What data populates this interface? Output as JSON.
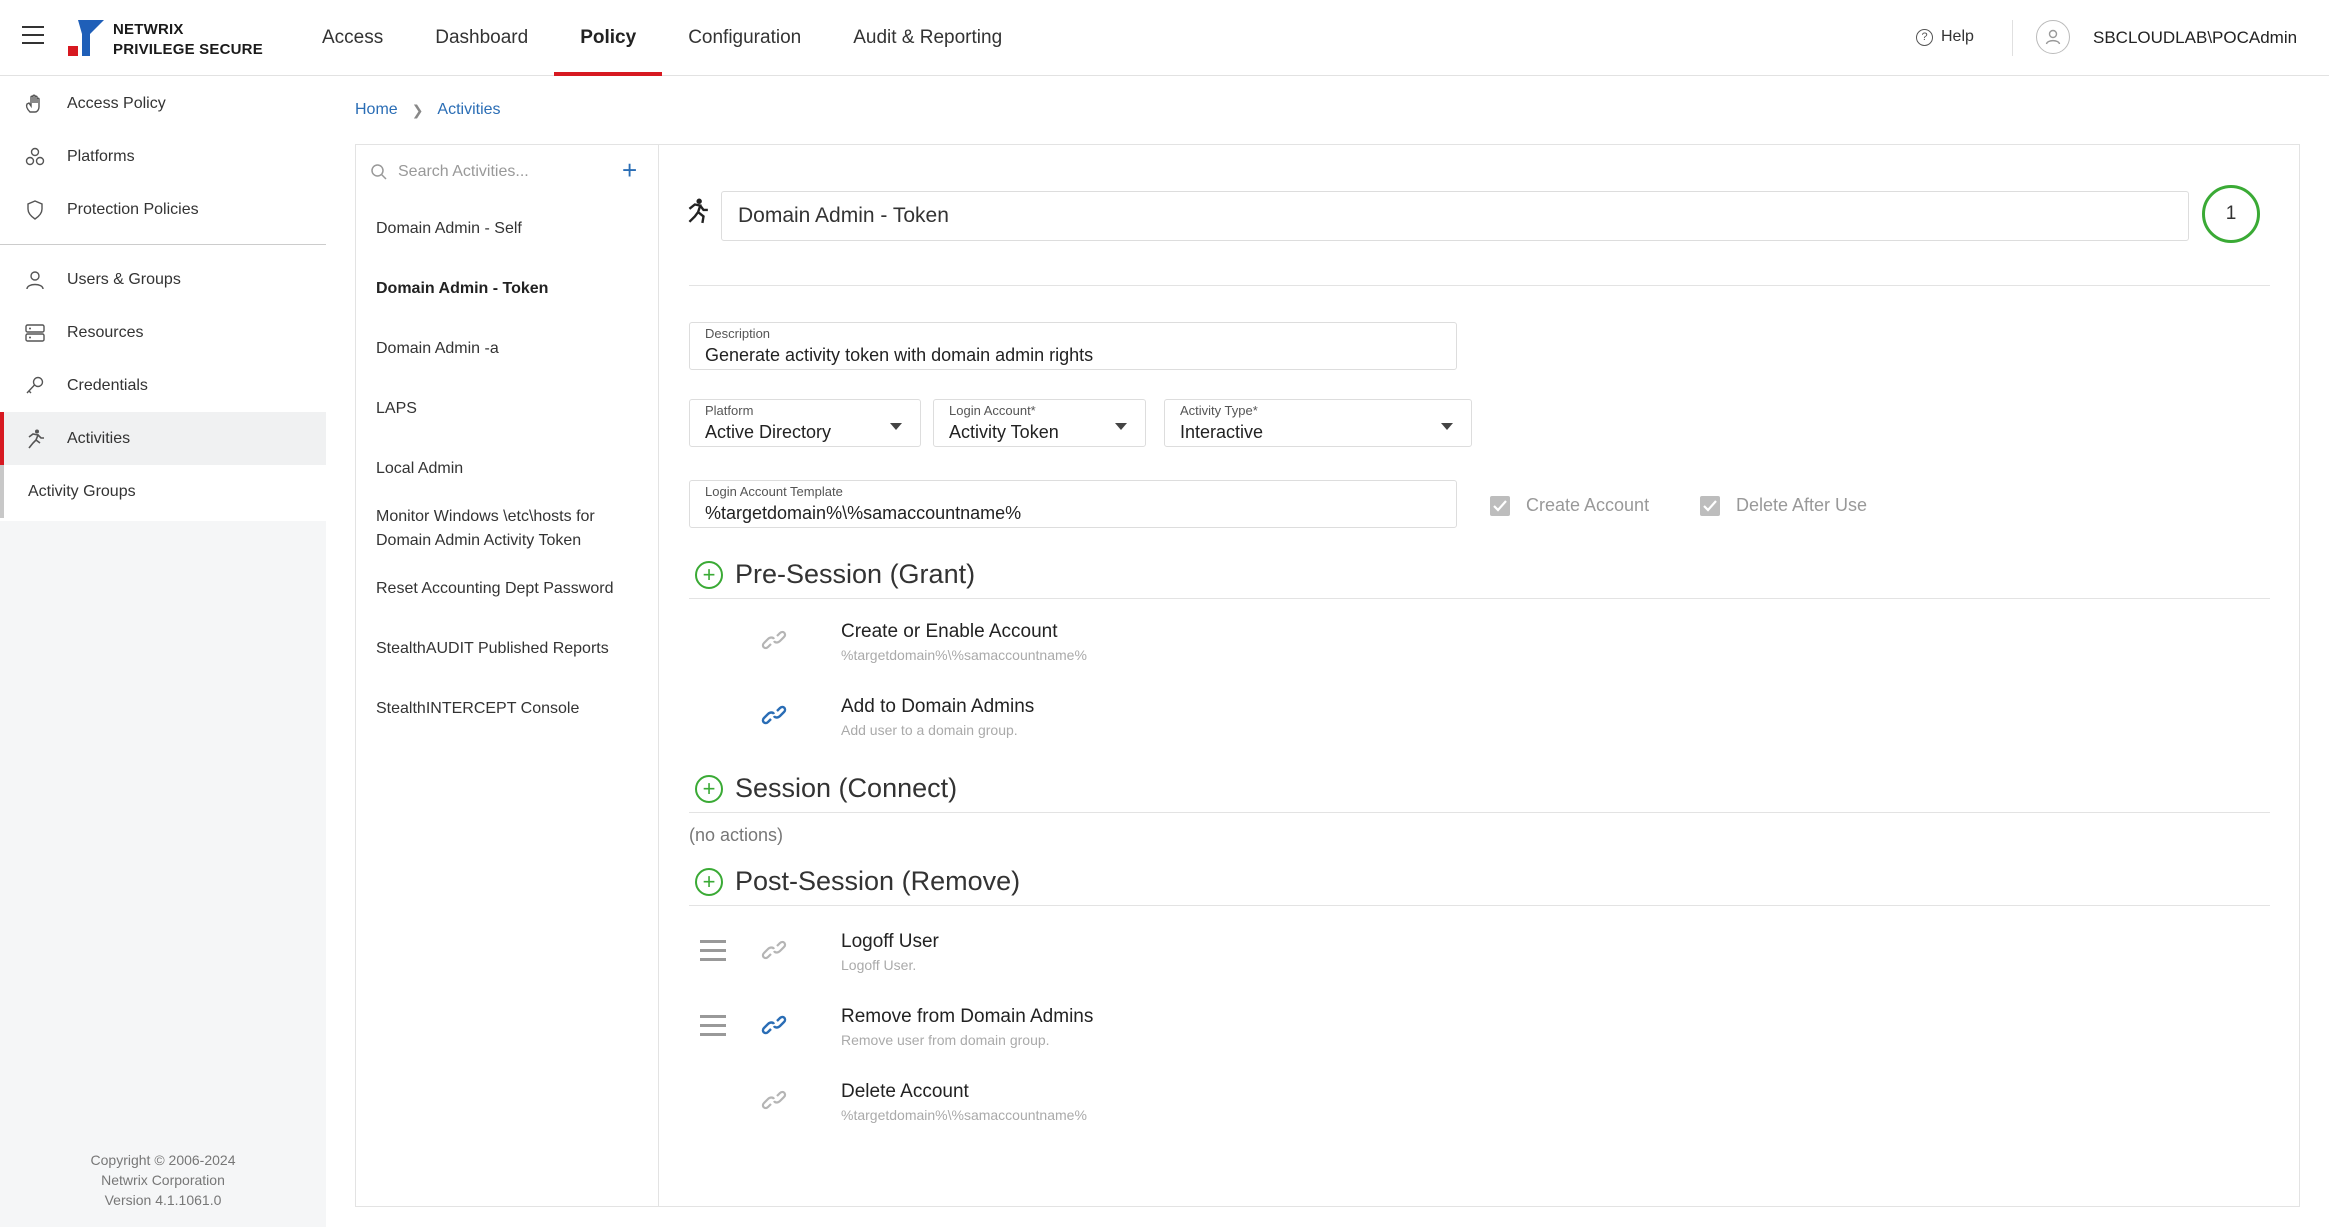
{
  "header": {
    "logo_line1": "NETWRIX",
    "logo_line2": "PRIVILEGE SECURE",
    "nav": [
      {
        "label": "Access"
      },
      {
        "label": "Dashboard"
      },
      {
        "label": "Policy"
      },
      {
        "label": "Configuration"
      },
      {
        "label": "Audit & Reporting"
      }
    ],
    "active_nav": "Policy",
    "help_label": "Help",
    "username": "SBCLOUDLAB\\POCAdmin",
    "accent_color": "#d71921"
  },
  "sidebar": {
    "items": [
      {
        "label": "Access Policy",
        "icon": "hand-icon"
      },
      {
        "label": "Platforms",
        "icon": "platforms-icon"
      },
      {
        "label": "Protection Policies",
        "icon": "shield-icon"
      },
      {
        "label": "Users & Groups",
        "icon": "user-icon"
      },
      {
        "label": "Resources",
        "icon": "server-icon"
      },
      {
        "label": "Credentials",
        "icon": "key-icon"
      },
      {
        "label": "Activities",
        "icon": "runner-icon"
      }
    ],
    "active_item": "Activities",
    "sub_item": "Activity Groups",
    "copyright_line1": "Copyright © 2006-2024",
    "copyright_line2": "Netwrix Corporation",
    "copyright_line3": "Version 4.1.1061.0"
  },
  "breadcrumb": {
    "home": "Home",
    "current": "Activities"
  },
  "activities_list": {
    "search_placeholder": "Search Activities...",
    "items": [
      {
        "label": "Domain Admin - Self"
      },
      {
        "label": "Domain Admin - Token"
      },
      {
        "label": "Domain Admin -a"
      },
      {
        "label": "LAPS"
      },
      {
        "label": "Local Admin"
      },
      {
        "label": "Monitor Windows \\etc\\hosts for Domain Admin Activity Token"
      },
      {
        "label": "Reset Accounting Dept Password"
      },
      {
        "label": "StealthAUDIT Published Reports"
      },
      {
        "label": "StealthINTERCEPT Console"
      }
    ],
    "selected": "Domain Admin - Token"
  },
  "detail": {
    "name": "Domain Admin - Token",
    "badge_count": "1",
    "description_label": "Description",
    "description_value": "Generate activity token with domain admin rights",
    "platform_label": "Platform",
    "platform_value": "Active Directory",
    "login_account_label": "Login Account*",
    "login_account_value": "Activity Token",
    "activity_type_label": "Activity Type*",
    "activity_type_value": "Interactive",
    "login_template_label": "Login Account Template",
    "login_template_value": "%targetdomain%\\%samaccountname%",
    "create_account_label": "Create Account",
    "create_account_checked": true,
    "delete_after_use_label": "Delete After Use",
    "delete_after_use_checked": true,
    "pre_session": {
      "title": "Pre-Session (Grant)",
      "actions": [
        {
          "name": "Create or Enable Account",
          "desc": "%targetdomain%\\%samaccountname%",
          "link_state": "inactive"
        },
        {
          "name": "Add to Domain Admins",
          "desc": "Add user to a domain group.",
          "link_state": "active"
        }
      ]
    },
    "session": {
      "title": "Session (Connect)",
      "empty_text": "(no actions)"
    },
    "post_session": {
      "title": "Post-Session (Remove)",
      "actions": [
        {
          "name": "Logoff User",
          "desc": "Logoff User.",
          "link_state": "inactive"
        },
        {
          "name": "Remove from Domain Admins",
          "desc": "Remove user from domain group.",
          "link_state": "active"
        },
        {
          "name": "Delete Account",
          "desc": "%targetdomain%\\%samaccountname%",
          "link_state": "inactive"
        }
      ]
    },
    "colors": {
      "green": "#3aaa35",
      "link_blue": "#2a6db5",
      "link_gray": "#b5b5b5"
    }
  }
}
